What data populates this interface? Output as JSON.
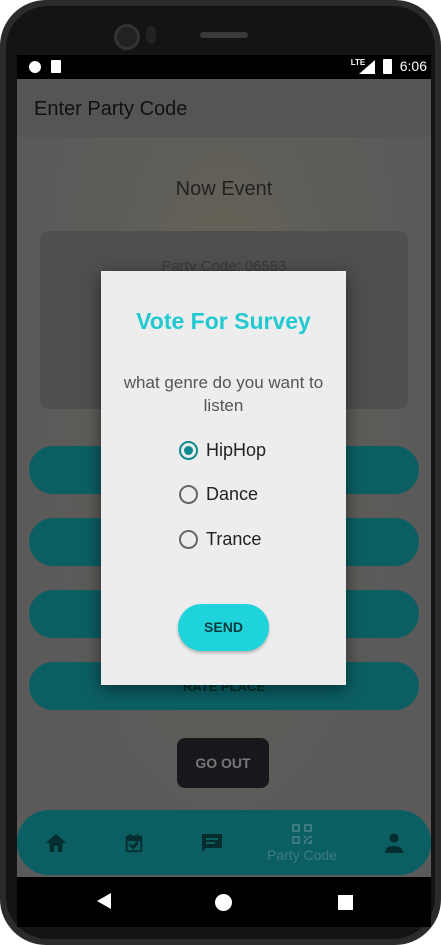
{
  "status_bar": {
    "time": "6:06",
    "network": "LTE",
    "icons": [
      "record-icon",
      "sd-card-icon",
      "lte-signal-icon",
      "battery-icon"
    ]
  },
  "app_bar": {
    "title": "Enter Party Code"
  },
  "event": {
    "title": "Now Event",
    "party_code_text": "Party Code: 06553"
  },
  "buttons": {
    "rate_place": "RATE PLACE",
    "go_out": "GO OUT"
  },
  "bottom_nav": {
    "items": [
      {
        "icon": "home-icon",
        "label": ""
      },
      {
        "icon": "calendar-icon",
        "label": ""
      },
      {
        "icon": "chat-icon",
        "label": ""
      },
      {
        "icon": "qr-code-icon",
        "label": "Party Code"
      },
      {
        "icon": "person-icon",
        "label": ""
      }
    ],
    "active_index": 3
  },
  "dialog": {
    "title": "Vote For Survey",
    "question": "what genre do you want to listen",
    "options": [
      {
        "label": "HipHop",
        "selected": true
      },
      {
        "label": "Dance",
        "selected": false
      },
      {
        "label": "Trance",
        "selected": false
      }
    ],
    "send_label": "SEND"
  },
  "colors": {
    "accent": "#22c9d1",
    "teal_dark": "#0b5f63",
    "dialog_bg": "#ededed"
  }
}
